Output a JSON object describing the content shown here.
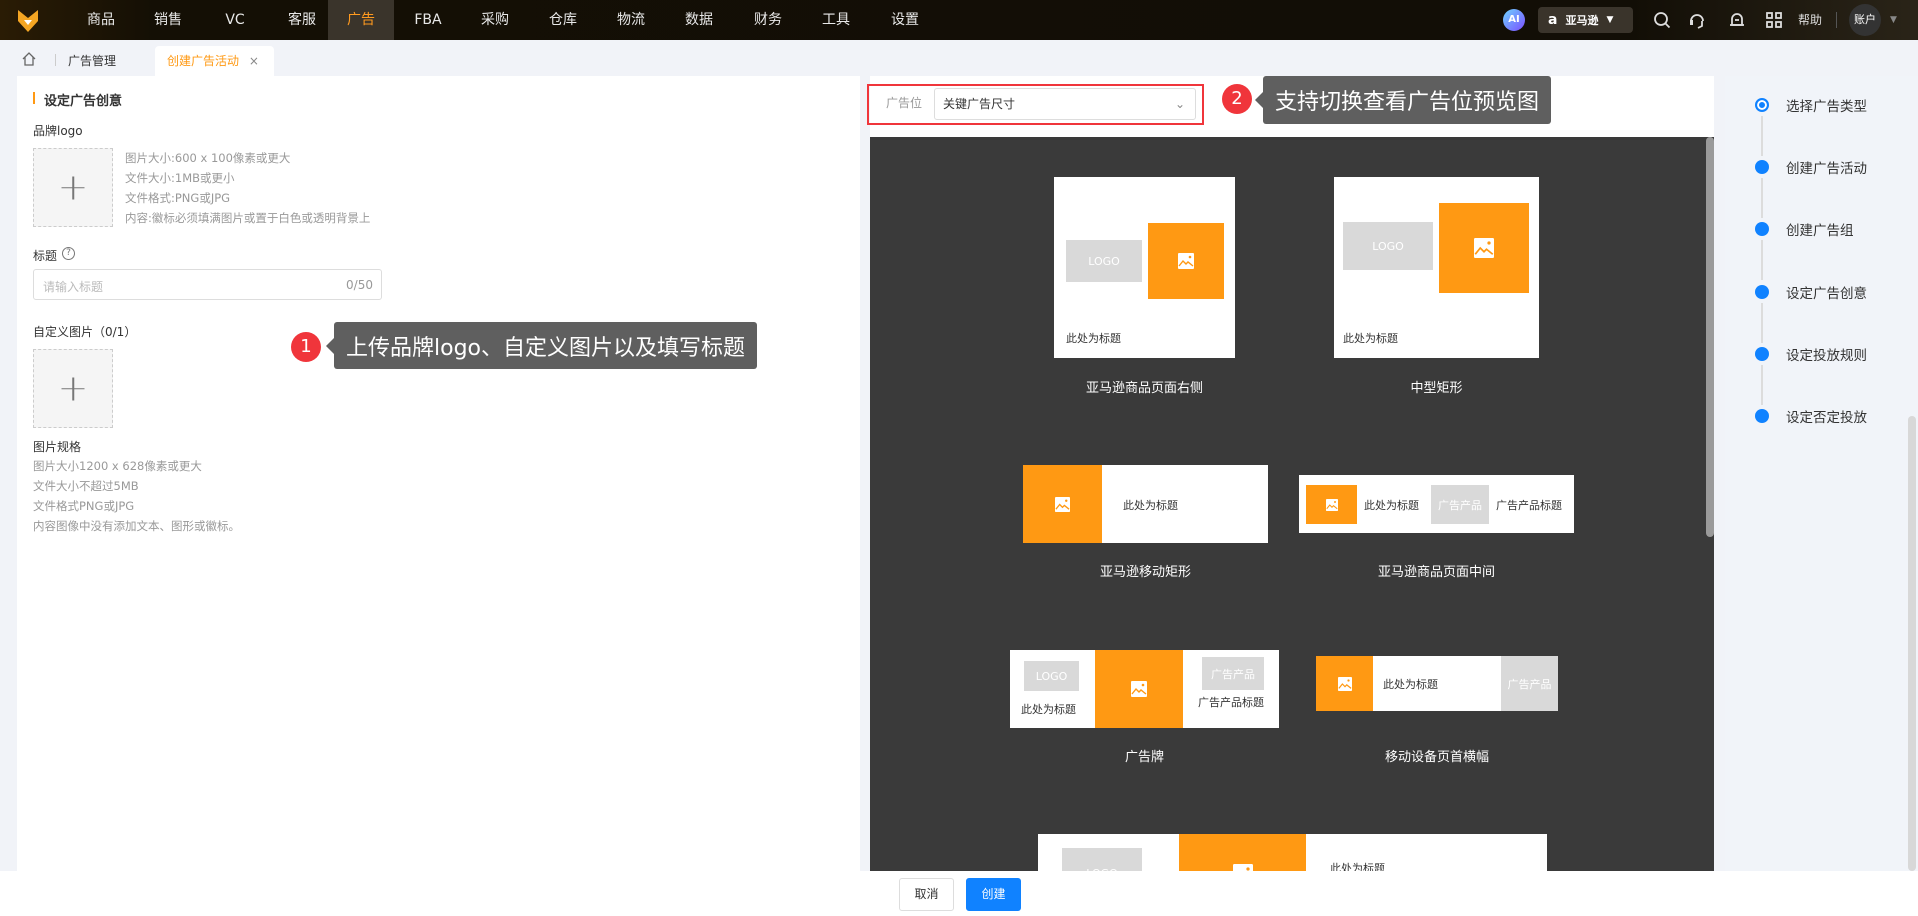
{
  "nav": {
    "items": [
      "商品",
      "销售",
      "VC",
      "客服",
      "广告",
      "FBA",
      "采购",
      "仓库",
      "物流",
      "数据",
      "财务",
      "工具",
      "设置"
    ],
    "active": "广告",
    "ai": "AI",
    "marketplace": "亚马逊",
    "help": "帮助",
    "account": "账户"
  },
  "tabs": {
    "home": "home",
    "items": [
      {
        "label": "广告管理"
      },
      {
        "label": "创建广告活动",
        "closable": "×"
      }
    ]
  },
  "form": {
    "section_title": "设定广告创意",
    "brand_logo_label": "品牌logo",
    "brand_logo_hints": [
      "图片大小:600 x 100像素或更大",
      "文件大小:1MB或更小",
      "文件格式:PNG或JPG",
      "内容:徽标必须填满图片或置于白色或透明背景上"
    ],
    "title_label": "标题",
    "title_placeholder": "请输入标题",
    "title_count": "0/50",
    "custom_image_label": "自定义图片（0/1）",
    "spec_title": "图片规格",
    "spec_lines": [
      "图片大小1200 x 628像素或更大",
      "文件大小不超过5MB",
      "文件格式PNG或JPG",
      "内容图像中没有添加文本、图形或徽标。"
    ]
  },
  "annotations": [
    {
      "num": "1",
      "text": "上传品牌logo、自定义图片以及填写标题"
    },
    {
      "num": "2",
      "text": "支持切换查看广告位预览图"
    }
  ],
  "preview": {
    "placement_label": "广告位",
    "placement_value": "关键广告尺寸",
    "logo": "LOGO",
    "title": "此处为标题",
    "product": "广告产品",
    "product_title": "广告产品标题",
    "captions": [
      "亚马逊商品页面右侧",
      "中型矩形",
      "亚马逊移动矩形",
      "亚马逊商品页面中间",
      "广告牌",
      "移动设备页首横幅"
    ]
  },
  "steps": [
    "选择广告类型",
    "创建广告活动",
    "创建广告组",
    "设定广告创意",
    "设定投放规则",
    "设定否定投放"
  ],
  "footer": {
    "cancel": "取消",
    "create": "创建"
  },
  "colors": {
    "accent": "#ff9913",
    "primary": "#1082ff",
    "badge": "#f0353b"
  }
}
